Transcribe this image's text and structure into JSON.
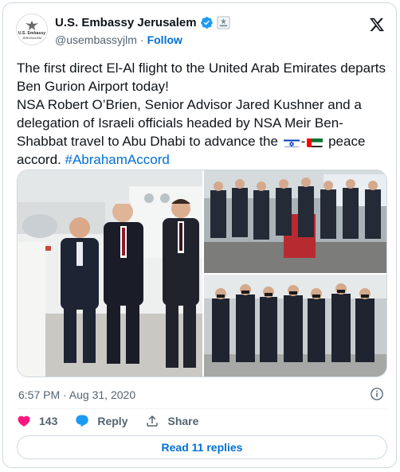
{
  "author": {
    "display_name": "U.S. Embassy Jerusalem",
    "handle": "@usembassyjlm",
    "follow_label": "Follow",
    "separator": "·",
    "avatar_text_top": "U.S. Embassy",
    "avatar_text_bottom": "JERUSALEM"
  },
  "tweet": {
    "line1": "The first direct El-Al flight to the United Arab Emirates departs Ben Gurion Airport today!",
    "line2_before_flags": "NSA Robert O’Brien, Senior Advisor Jared Kushner and a delegation of Israeli officials headed by NSA Meir Ben-Shabbat travel to Abu Dhabi to advance the ",
    "flag_separator": "-",
    "line2_after_flags": " peace accord. ",
    "hashtag": "#AbrahamAccord"
  },
  "meta": {
    "timestamp": "6:57 PM · Aug 31, 2020"
  },
  "actions": {
    "like_count": "143",
    "reply_label": "Reply",
    "share_label": "Share"
  },
  "read_replies_label": "Read 11 replies",
  "colors": {
    "link_blue": "#006fd6",
    "like_pink": "#f91880",
    "verified_blue": "#1d9bf0",
    "secondary_text": "#536471",
    "border": "#cfd9de"
  }
}
